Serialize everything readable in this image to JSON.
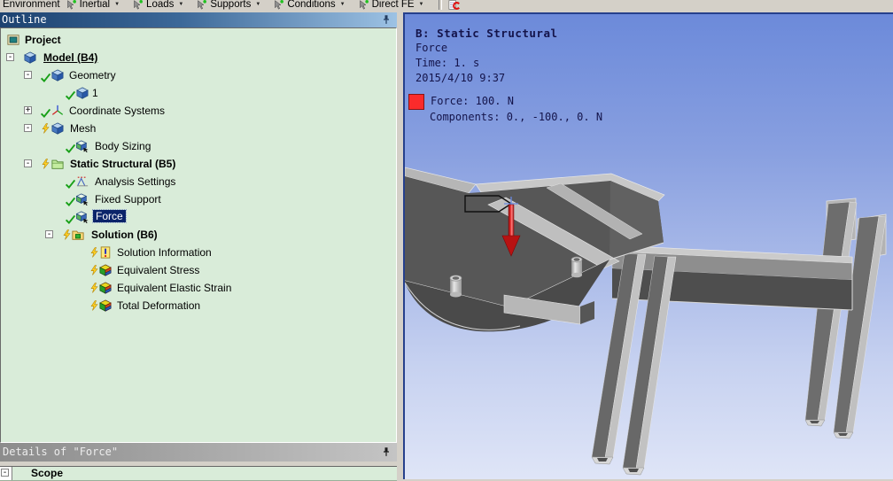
{
  "toolbar": {
    "menu_label": "Environment",
    "dropdown_glyph": "▼",
    "buttons": [
      {
        "label": "Inertial",
        "icon": "inertial-icon"
      },
      {
        "label": "Loads",
        "icon": "loads-icon"
      },
      {
        "label": "Supports",
        "icon": "supports-icon"
      },
      {
        "label": "Conditions",
        "icon": "conditions-icon"
      },
      {
        "label": "Direct FE",
        "icon": "direct-fe-icon"
      }
    ],
    "extra_icon": "commands-icon"
  },
  "outline": {
    "title": "Outline",
    "items": [
      {
        "label": "Project",
        "icon": "project-icon"
      },
      {
        "label": "Model (B4)",
        "icon": "model-icon",
        "expand": "minus",
        "bold": true,
        "underline": true
      },
      {
        "label": "Geometry",
        "icon": "geometry-icon",
        "expand": "minus",
        "check": true
      },
      {
        "label": "1",
        "icon": "body-icon",
        "check": true
      },
      {
        "label": "Coordinate Systems",
        "icon": "coordinate-systems-icon",
        "expand": "plus",
        "check": true
      },
      {
        "label": "Mesh",
        "icon": "mesh-icon",
        "expand": "minus",
        "bolt": true
      },
      {
        "label": "Body Sizing",
        "icon": "body-sizing-icon",
        "check": true
      },
      {
        "label": "Static Structural (B5)",
        "icon": "static-structural-icon",
        "expand": "minus",
        "bolt": true,
        "bold": true
      },
      {
        "label": "Analysis Settings",
        "icon": "analysis-settings-icon",
        "check": true
      },
      {
        "label": "Fixed Support",
        "icon": "fixed-support-icon",
        "check": true
      },
      {
        "label": "Force",
        "icon": "force-icon",
        "check": true,
        "selected": true
      },
      {
        "label": "Solution (B6)",
        "icon": "solution-icon",
        "expand": "minus",
        "bolt": true,
        "bold": true
      },
      {
        "label": "Solution Information",
        "icon": "solution-information-icon",
        "bolt": true
      },
      {
        "label": "Equivalent Stress",
        "icon": "equivalent-stress-icon",
        "bolt": true
      },
      {
        "label": "Equivalent Elastic Strain",
        "icon": "equivalent-elastic-strain-icon",
        "bolt": true
      },
      {
        "label": "Total Deformation",
        "icon": "total-deformation-icon",
        "bolt": true
      }
    ]
  },
  "details": {
    "title": "Details of \"Force\"",
    "rows": [
      {
        "label": "Scope"
      }
    ]
  },
  "viewport": {
    "annotation": {
      "title": "B: Static Structural",
      "line2": "Force",
      "line3": "Time: 1. s",
      "line4": "2015/4/10 9:37"
    },
    "legend": {
      "force": "Force: 100. N",
      "components": "Components: 0., -100., 0. N",
      "swatch_color": "#fb2b2b"
    }
  },
  "colors": {
    "tree_background": "#d9ecd9",
    "selection": "#0b246a",
    "outline_titlebar": "#1d4270",
    "viewport_gradient_top": "#6c8ada",
    "viewport_gradient_bottom": "#dfe5f7",
    "model_light_gray": "#c2c2c2",
    "model_dark_gray": "#4e4e4e",
    "force_arrow_red": "#b81212",
    "annotation_text": "#14144a"
  }
}
